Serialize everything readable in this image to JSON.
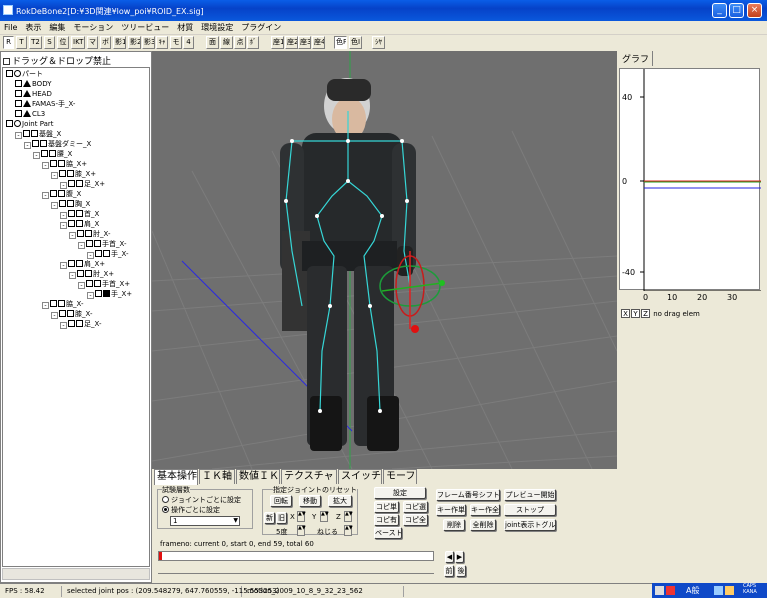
{
  "window": {
    "title": "RokDeBone2[D:¥3D関連¥low_poi¥ROID_EX.sig]",
    "minimize": "_",
    "maximize": "□",
    "close": "×"
  },
  "menu": [
    "File",
    "表示",
    "編集",
    "モーション",
    "ツリービュー",
    "材質",
    "環境設定",
    "プラグイン"
  ],
  "toolbar": [
    "R",
    "T",
    "T2",
    "S",
    "位",
    "IKT",
    "マ",
    "ボ",
    "影1",
    "影2",
    "影3",
    "ｷｬ",
    "モ",
    "4",
    "面",
    "線",
    "点",
    "ﾎﾞ",
    "座1",
    "座2",
    "座3",
    "座4",
    "色P",
    "色I",
    "ｼﾔ"
  ],
  "left_panel": {
    "drag_drop_label": "ドラッグ＆ドロップ禁止",
    "tree": [
      {
        "label": "パート",
        "indent": 0,
        "icon": "circle"
      },
      {
        "label": "BODY",
        "indent": 1,
        "icon": "tri"
      },
      {
        "label": "HEAD",
        "indent": 1,
        "icon": "tri"
      },
      {
        "label": "FAMAS-手_X-",
        "indent": 1,
        "icon": "tri"
      },
      {
        "label": "CL3",
        "indent": 1,
        "icon": "tri"
      },
      {
        "label": "Joint Part",
        "indent": 0,
        "icon": "circle"
      },
      {
        "label": "基盤_X",
        "indent": 1,
        "icon": "sq"
      },
      {
        "label": "基盤ダミー_X",
        "indent": 2,
        "icon": "sq"
      },
      {
        "label": "腰_X",
        "indent": 3,
        "icon": "sq"
      },
      {
        "label": "脇_X+",
        "indent": 4,
        "icon": "sq"
      },
      {
        "label": "膝_X+",
        "indent": 5,
        "icon": "sq"
      },
      {
        "label": "足_X+",
        "indent": 6,
        "icon": "sq"
      },
      {
        "label": "腹_X",
        "indent": 4,
        "icon": "sq"
      },
      {
        "label": "胸_X",
        "indent": 5,
        "icon": "sq"
      },
      {
        "label": "首_X",
        "indent": 6,
        "icon": "sq"
      },
      {
        "label": "肩_X",
        "indent": 6,
        "icon": "sq"
      },
      {
        "label": "肘_X-",
        "indent": 7,
        "icon": "sq"
      },
      {
        "label": "手首_X-",
        "indent": 8,
        "icon": "sq"
      },
      {
        "label": "手_X-",
        "indent": 9,
        "icon": "sq"
      },
      {
        "label": "肩_X+",
        "indent": 6,
        "icon": "sq"
      },
      {
        "label": "肘_X+",
        "indent": 7,
        "icon": "sq"
      },
      {
        "label": "手首_X+",
        "indent": 8,
        "icon": "sq"
      },
      {
        "label": "手_X+",
        "indent": 9,
        "icon": "sqblk"
      },
      {
        "label": "脇_X-",
        "indent": 4,
        "icon": "sq"
      },
      {
        "label": "膝_X-",
        "indent": 5,
        "icon": "sq"
      },
      {
        "label": "足_X-",
        "indent": 6,
        "icon": "sq"
      }
    ]
  },
  "graph": {
    "tab_label": "グラフ",
    "y_ticks": [
      "40",
      "0",
      "-40"
    ],
    "x_ticks": [
      "0",
      "10",
      "20",
      "30"
    ],
    "axis_buttons": [
      "X",
      "Y",
      "Z"
    ],
    "status": "no drag elem"
  },
  "bottom": {
    "tabs": [
      "基本操作",
      "ＩＫ軸",
      "数値ＩＫ",
      "テクスチャ",
      "スイッチ",
      "モーフ"
    ],
    "interp_group": "試験層数",
    "radio_joint": "ジョイントごとに設定",
    "radio_op": "操作ごとに設定",
    "select_value": "1",
    "reset_group": "指定ジョイントのリセット",
    "rotate": "回転",
    "move": "移動",
    "scale": "拡大",
    "new": "新",
    "old": "旧",
    "x": "X",
    "y": "Y",
    "z": "Z",
    "deg5": "5度",
    "twist": "ねじる",
    "settings": "設定",
    "copy_single": "コピ単",
    "copy_sel": "コピ選",
    "copy_have": "コピ有",
    "copy_all": "コピ全",
    "paste": "ペースト",
    "frame_shift": "フレーム番号シフト",
    "key_single": "キー作単",
    "key_all": "キー作全",
    "delete": "削除",
    "delete_all": "全削除",
    "preview_start": "プレビュー開始",
    "stop": "ストップ",
    "joint_toggle": "joint表示トグル",
    "frame_info": "frameno: current 0, start 0, end 59, total 60",
    "prev": "前",
    "next": "後"
  },
  "status": {
    "fps": "FPS : 58.42",
    "joint_pos": "selected joint pos : (209.548279, 647.760559, -115.553253)",
    "motion": "motion_2009_10_8_9_32_23_562"
  },
  "tray": {
    "lang": "A般",
    "caps": "CAPS",
    "kana": "KANA"
  }
}
